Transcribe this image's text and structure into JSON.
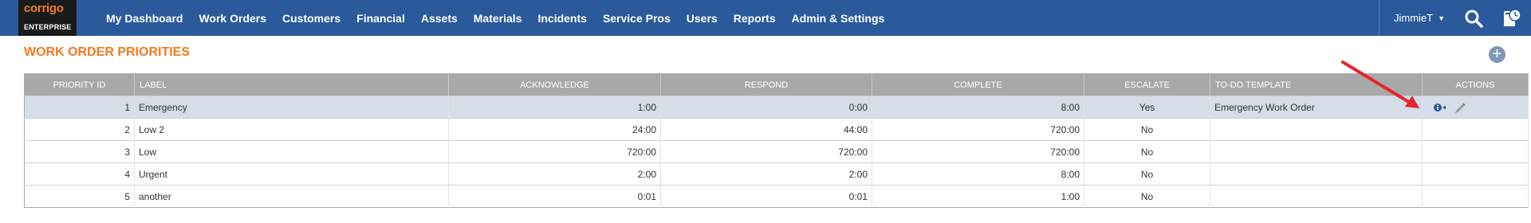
{
  "app": {
    "logo_brand": "corrigo",
    "logo_sub": "ENTERPRISE"
  },
  "nav": {
    "items": [
      "My Dashboard",
      "Work Orders",
      "Customers",
      "Financial",
      "Assets",
      "Materials",
      "Incidents",
      "Service Pros",
      "Users",
      "Reports",
      "Admin & Settings"
    ],
    "user": "JimmieT",
    "icons": [
      "search-icon",
      "calendar-clock-icon"
    ]
  },
  "page": {
    "title": "WORK ORDER PRIORITIES",
    "add_icon": "plus-circle-icon"
  },
  "table": {
    "headers": [
      "PRIORITY ID",
      "LABEL",
      "ACKNOWLEDGE",
      "RESPOND",
      "COMPLETE",
      "ESCALATE",
      "TO-DO TEMPLATE",
      "ACTIONS"
    ],
    "rows": [
      {
        "id": "1",
        "label": "Emergency",
        "acknowledge": "1:00",
        "respond": "0:00",
        "complete": "8:00",
        "escalate": "Yes",
        "template": "Emergency Work Order",
        "selected": true
      },
      {
        "id": "2",
        "label": "Low 2",
        "acknowledge": "24:00",
        "respond": "44:00",
        "complete": "720:00",
        "escalate": "No",
        "template": ""
      },
      {
        "id": "3",
        "label": "Low",
        "acknowledge": "720:00",
        "respond": "720:00",
        "complete": "720:00",
        "escalate": "No",
        "template": ""
      },
      {
        "id": "4",
        "label": "Urgent",
        "acknowledge": "2:00",
        "respond": "2:00",
        "complete": "8:00",
        "escalate": "No",
        "template": ""
      },
      {
        "id": "5",
        "label": "another",
        "acknowledge": "0:01",
        "respond": "0:01",
        "complete": "1:00",
        "escalate": "No",
        "template": ""
      }
    ],
    "action_icons": [
      "info-icon",
      "edit-pencil-icon"
    ]
  },
  "colors": {
    "topbar": "#2a5a9c",
    "accent_orange": "#f47920",
    "header_gray": "#a8a8a8",
    "selected_row": "#d4dde8",
    "annotation_arrow": "#e8232a"
  }
}
